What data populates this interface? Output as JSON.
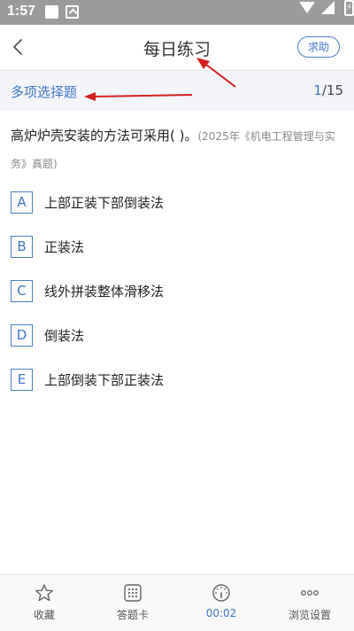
{
  "status_bar": {
    "time": "1:57"
  },
  "header": {
    "title": "每日练习",
    "help_label": "求助"
  },
  "type_bar": {
    "question_type": "多项选择题",
    "progress_current": "1",
    "progress_total": "/15"
  },
  "question": {
    "text": "高炉炉壳安装的方法可采用( )。",
    "source": "(2025年《机电工程管理与实务》真题)"
  },
  "options": [
    {
      "letter": "A",
      "text": "上部正装下部倒装法"
    },
    {
      "letter": "B",
      "text": "正装法"
    },
    {
      "letter": "C",
      "text": "线外拼装整体滑移法"
    },
    {
      "letter": "D",
      "text": "倒装法"
    },
    {
      "letter": "E",
      "text": "上部倒装下部正装法"
    }
  ],
  "bottom_bar": {
    "items": [
      {
        "label": "收藏",
        "icon": "star-icon"
      },
      {
        "label": "答题卡",
        "icon": "grid-icon"
      },
      {
        "label": "00:02",
        "icon": "timer-icon"
      },
      {
        "label": "浏览设置",
        "icon": "more-icon"
      }
    ]
  },
  "colors": {
    "accent": "#3f76c6",
    "status_bar": "#9b9b9b",
    "type_bar_bg": "#f3f5f9",
    "annotation_arrow": "#d32020"
  }
}
